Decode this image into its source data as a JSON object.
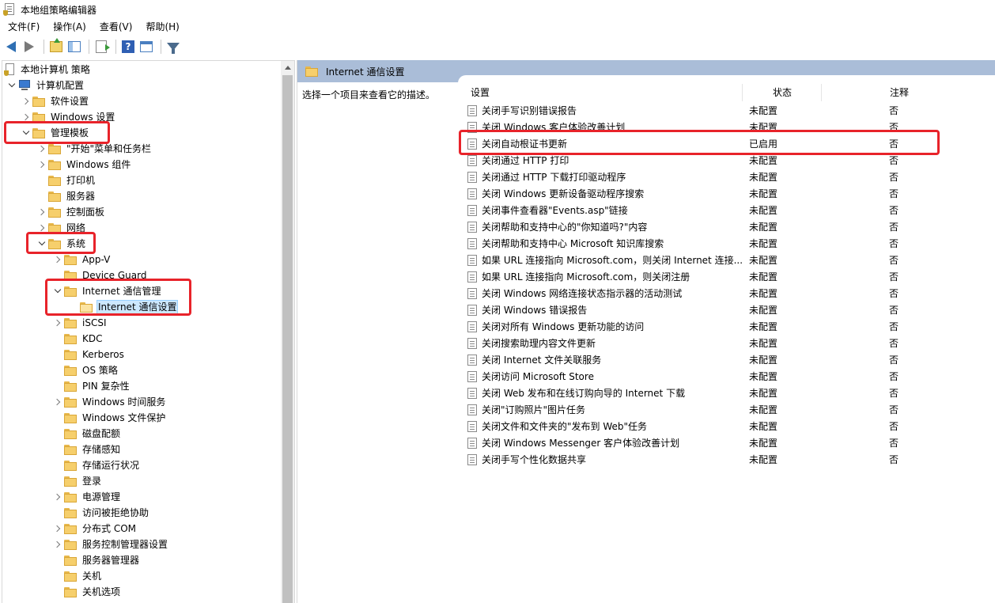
{
  "window": {
    "title": "本地组策略编辑器"
  },
  "menu": [
    "文件(F)",
    "操作(A)",
    "查看(V)",
    "帮助(H)"
  ],
  "toolbar": {
    "icons": [
      "back-arrow-icon",
      "forward-arrow-icon",
      "up-folder-icon",
      "show-hide-tree-icon",
      "export-list-icon",
      "help-icon",
      "properties-icon",
      "filter-icon"
    ]
  },
  "tree": [
    {
      "label": "本地计算机 策略",
      "icon": "policy",
      "expander": "none"
    },
    {
      "label": "计算机配置",
      "icon": "computer",
      "expander": "down"
    },
    {
      "label": "软件设置",
      "icon": "folder",
      "expander": "right"
    },
    {
      "label": "Windows 设置",
      "icon": "folder",
      "expander": "right"
    },
    {
      "label": "管理模板",
      "icon": "folder",
      "expander": "down"
    },
    {
      "label": "\"开始\"菜单和任务栏",
      "icon": "folder",
      "expander": "right"
    },
    {
      "label": "Windows 组件",
      "icon": "folder",
      "expander": "right"
    },
    {
      "label": "打印机",
      "icon": "folder",
      "expander": "none"
    },
    {
      "label": "服务器",
      "icon": "folder",
      "expander": "none"
    },
    {
      "label": "控制面板",
      "icon": "folder",
      "expander": "right"
    },
    {
      "label": "网络",
      "icon": "folder",
      "expander": "right"
    },
    {
      "label": "系统",
      "icon": "folder",
      "expander": "down"
    },
    {
      "label": "App-V",
      "icon": "folder",
      "expander": "right"
    },
    {
      "label": "Device Guard",
      "icon": "folder",
      "expander": "none"
    },
    {
      "label": "Internet 通信管理",
      "icon": "folder",
      "expander": "down"
    },
    {
      "label": "Internet 通信设置",
      "icon": "folder-open",
      "expander": "none",
      "selected": true
    },
    {
      "label": "iSCSI",
      "icon": "folder",
      "expander": "right"
    },
    {
      "label": "KDC",
      "icon": "folder",
      "expander": "none"
    },
    {
      "label": "Kerberos",
      "icon": "folder",
      "expander": "none"
    },
    {
      "label": "OS 策略",
      "icon": "folder",
      "expander": "none"
    },
    {
      "label": "PIN 复杂性",
      "icon": "folder",
      "expander": "none"
    },
    {
      "label": "Windows 时间服务",
      "icon": "folder",
      "expander": "right"
    },
    {
      "label": "Windows 文件保护",
      "icon": "folder",
      "expander": "none"
    },
    {
      "label": "磁盘配额",
      "icon": "folder",
      "expander": "none"
    },
    {
      "label": "存储感知",
      "icon": "folder",
      "expander": "none"
    },
    {
      "label": "存储运行状况",
      "icon": "folder",
      "expander": "none"
    },
    {
      "label": "登录",
      "icon": "folder",
      "expander": "none"
    },
    {
      "label": "电源管理",
      "icon": "folder",
      "expander": "right"
    },
    {
      "label": "访问被拒绝协助",
      "icon": "folder",
      "expander": "none"
    },
    {
      "label": "分布式 COM",
      "icon": "folder",
      "expander": "right"
    },
    {
      "label": "服务控制管理器设置",
      "icon": "folder",
      "expander": "right"
    },
    {
      "label": "服务器管理器",
      "icon": "folder",
      "expander": "none"
    },
    {
      "label": "关机",
      "icon": "folder",
      "expander": "none"
    },
    {
      "label": "关机选项",
      "icon": "folder",
      "expander": "none"
    }
  ],
  "right_pane": {
    "header_title": "Internet 通信设置",
    "description": "选择一个项目来查看它的描述。",
    "columns": {
      "setting": "设置",
      "state": "状态",
      "comment": "注释"
    },
    "rows": [
      {
        "name": "关闭手写识别错误报告",
        "state": "未配置",
        "comment": "否"
      },
      {
        "name": "关闭 Windows 客户体验改善计划",
        "state": "未配置",
        "comment": "否"
      },
      {
        "name": "关闭自动根证书更新",
        "state": "已启用",
        "comment": "否"
      },
      {
        "name": "关闭通过 HTTP 打印",
        "state": "未配置",
        "comment": "否"
      },
      {
        "name": "关闭通过 HTTP 下载打印驱动程序",
        "state": "未配置",
        "comment": "否"
      },
      {
        "name": "关闭 Windows 更新设备驱动程序搜索",
        "state": "未配置",
        "comment": "否"
      },
      {
        "name": "关闭事件查看器\"Events.asp\"链接",
        "state": "未配置",
        "comment": "否"
      },
      {
        "name": "关闭帮助和支持中心的\"你知道吗?\"内容",
        "state": "未配置",
        "comment": "否"
      },
      {
        "name": "关闭帮助和支持中心 Microsoft 知识库搜索",
        "state": "未配置",
        "comment": "否"
      },
      {
        "name": "如果 URL 连接指向 Microsoft.com，则关闭 Internet 连接...",
        "state": "未配置",
        "comment": "否"
      },
      {
        "name": "如果 URL 连接指向 Microsoft.com，则关闭注册",
        "state": "未配置",
        "comment": "否"
      },
      {
        "name": "关闭 Windows 网络连接状态指示器的活动测试",
        "state": "未配置",
        "comment": "否"
      },
      {
        "name": "关闭 Windows 错误报告",
        "state": "未配置",
        "comment": "否"
      },
      {
        "name": "关闭对所有 Windows 更新功能的访问",
        "state": "未配置",
        "comment": "否"
      },
      {
        "name": "关闭搜索助理内容文件更新",
        "state": "未配置",
        "comment": "否"
      },
      {
        "name": "关闭 Internet 文件关联服务",
        "state": "未配置",
        "comment": "否"
      },
      {
        "name": "关闭访问 Microsoft Store",
        "state": "未配置",
        "comment": "否"
      },
      {
        "name": "关闭 Web 发布和在线订购向导的 Internet 下载",
        "state": "未配置",
        "comment": "否"
      },
      {
        "name": "关闭\"订购照片\"图片任务",
        "state": "未配置",
        "comment": "否"
      },
      {
        "name": "关闭文件和文件夹的\"发布到 Web\"任务",
        "state": "未配置",
        "comment": "否"
      },
      {
        "name": "关闭 Windows Messenger 客户体验改善计划",
        "state": "未配置",
        "comment": "否"
      },
      {
        "name": "关闭手写个性化数据共享",
        "state": "未配置",
        "comment": "否"
      }
    ]
  },
  "annotation_color": "#e8232a"
}
